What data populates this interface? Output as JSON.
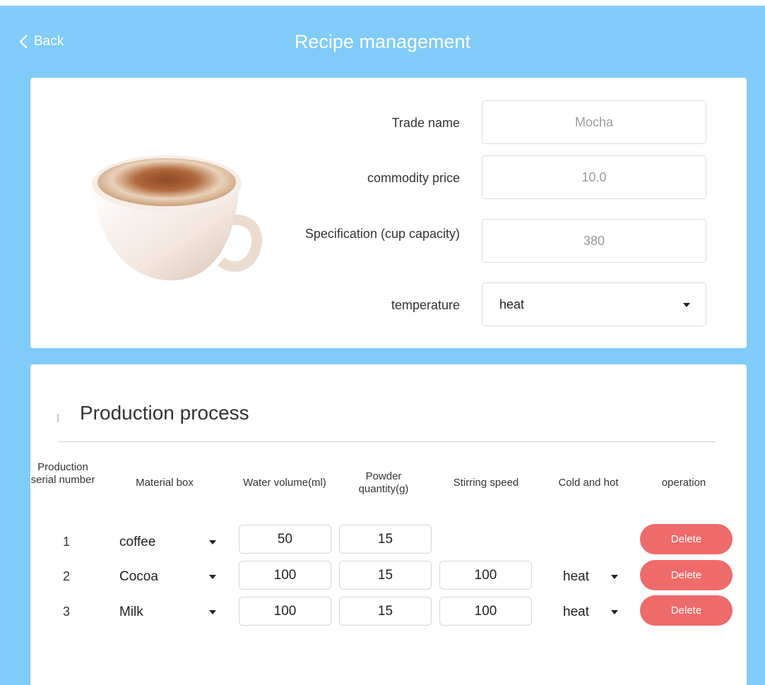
{
  "header": {
    "back_label": "Back",
    "title": "Recipe management"
  },
  "product": {
    "image": "cappuccino-cup-image",
    "fields": [
      {
        "label": "Trade name",
        "value": "Mocha"
      },
      {
        "label": "commodity price",
        "value": "10.0"
      },
      {
        "label": "Specification (cup capacity)",
        "value": "380"
      }
    ],
    "temperature": {
      "label": "temperature",
      "value": "heat"
    }
  },
  "process": {
    "title": "Production process",
    "columns": [
      "Production serial number",
      "Material box",
      "Water volume(ml)",
      "Powder quantity(g)",
      "Stirring speed",
      "Cold and hot",
      "operation"
    ],
    "rows": [
      {
        "num": "1",
        "material": "coffee",
        "water": "50",
        "powder": "15",
        "speed": "",
        "temp": "",
        "action": "Delete"
      },
      {
        "num": "2",
        "material": "Cocoa",
        "water": "100",
        "powder": "15",
        "speed": "100",
        "temp": "heat",
        "action": "Delete"
      },
      {
        "num": "3",
        "material": "Milk",
        "water": "100",
        "powder": "15",
        "speed": "100",
        "temp": "heat",
        "action": "Delete"
      }
    ]
  },
  "colors": {
    "background": "#80cbf8",
    "delete_button": "#ee6b6b"
  },
  "icons": {
    "back": "chevron-left-icon",
    "dropdown": "caret-down-icon"
  }
}
